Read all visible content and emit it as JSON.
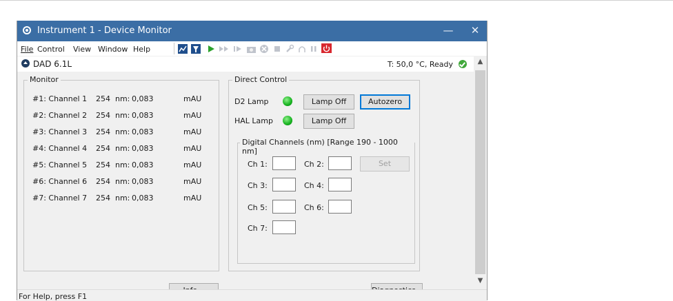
{
  "window": {
    "title": "Instrument 1 - Device Monitor",
    "minimize": "—",
    "close": "✕"
  },
  "menu": {
    "file": "File",
    "control": "Control",
    "view": "View",
    "window": "Window",
    "help": "Help"
  },
  "module": {
    "name": "DAD 6.1L",
    "status": "T: 50,0 °C, Ready"
  },
  "monitor": {
    "title": "Monitor",
    "channels": [
      {
        "label": "#1: Channel 1",
        "wavelength": "254",
        "unit_nm": "nm:",
        "value": "0,083",
        "unit": "mAU"
      },
      {
        "label": "#2: Channel 2",
        "wavelength": "254",
        "unit_nm": "nm:",
        "value": "0,083",
        "unit": "mAU"
      },
      {
        "label": "#3: Channel 3",
        "wavelength": "254",
        "unit_nm": "nm:",
        "value": "0,083",
        "unit": "mAU"
      },
      {
        "label": "#4: Channel 4",
        "wavelength": "254",
        "unit_nm": "nm:",
        "value": "0,083",
        "unit": "mAU"
      },
      {
        "label": "#5: Channel 5",
        "wavelength": "254",
        "unit_nm": "nm:",
        "value": "0,083",
        "unit": "mAU"
      },
      {
        "label": "#6: Channel 6",
        "wavelength": "254",
        "unit_nm": "nm:",
        "value": "0,083",
        "unit": "mAU"
      },
      {
        "label": "#7: Channel 7",
        "wavelength": "254",
        "unit_nm": "nm:",
        "value": "0,083",
        "unit": "mAU"
      }
    ]
  },
  "direct_control": {
    "title": "Direct Control",
    "d2_lamp_label": "D2 Lamp",
    "d2_lamp_button": "Lamp Off",
    "autozero_button": "Autozero",
    "hal_lamp_label": "HAL Lamp",
    "hal_lamp_button": "Lamp Off",
    "lamp_color": "#22b222",
    "digital": {
      "title": "Digital Channels (nm) [Range 190 - 1000 nm]",
      "set_button": "Set",
      "ch1": "Ch 1:",
      "ch2": "Ch 2:",
      "ch3": "Ch 3:",
      "ch4": "Ch 4:",
      "ch5": "Ch 5:",
      "ch6": "Ch 6:",
      "ch7": "Ch 7:"
    }
  },
  "buttons": {
    "info": "Info...",
    "diagnostics": "Diagnostics..."
  },
  "statusbar": {
    "help": "For Help, press F1"
  },
  "colors": {
    "titlebar": "#3b6ea5",
    "accent": "#0078d7",
    "ready": "#41a83b",
    "stop_button": "#d9272e"
  },
  "toolbar_icons": [
    "chart-icon",
    "filter-icon",
    "play-icon",
    "fast-forward-icon",
    "skip-icon",
    "camera-icon",
    "cancel-icon",
    "stop-icon",
    "wrench-icon",
    "lamp-icon",
    "pause-icon",
    "power-icon"
  ]
}
